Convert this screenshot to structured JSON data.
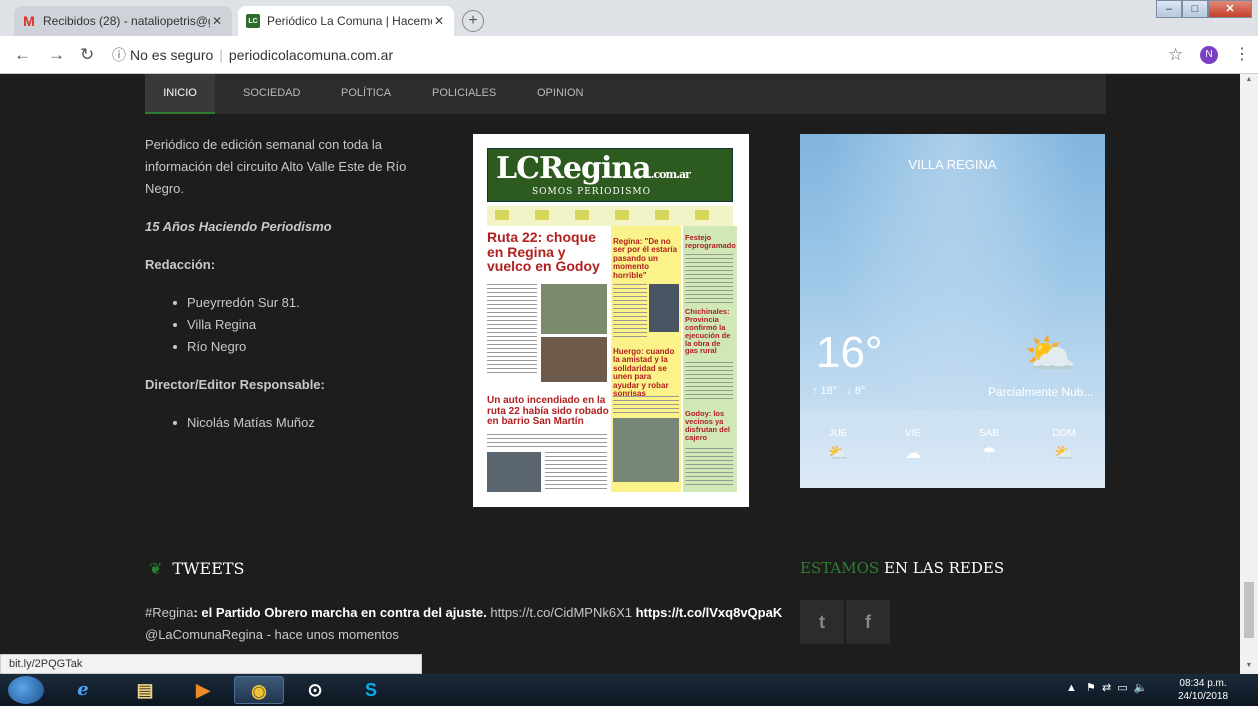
{
  "browser": {
    "tabs": [
      {
        "label": "Recibidos (28) - nataliopetris@g",
        "favicon": "gmail-icon"
      },
      {
        "label": "Periódico La Comuna | Hacemos",
        "favicon": "lc-favicon"
      }
    ],
    "security": "No es seguro",
    "url": "periodicolacomuna.com.ar",
    "profile_initial": "N"
  },
  "nav": {
    "items": [
      "INICIO",
      "SOCIEDAD",
      "POLÍTICA",
      "POLICIALES",
      "OPINION"
    ],
    "active": "INICIO"
  },
  "about": {
    "description": "Periódico de edición semanal con toda la información del circuito Alto Valle Este de Río Negro.",
    "tagline": "15 Años Haciendo Periodismo",
    "redaccion_label": "Redacción:",
    "address": [
      "Pueyrredón Sur 81.",
      "Villa Regina",
      "Río Negro"
    ],
    "director_label": "Director/Editor Responsable:",
    "director": "Nicolás Matías Muñoz"
  },
  "newspaper": {
    "logo": "LCRegina",
    "logo_suffix": ".com.ar",
    "subtitle": "SOMOS PERIODISMO",
    "headline_main": "Ruta 22: choque en Regina y vuelco en Godoy",
    "headline_second": "Un auto incendiado en la ruta 22 había sido robado en barrio San Martín",
    "col2_title": "Regina: \"De no ser por él estaría pasando un momento horrible\"",
    "col2_second": "Huergo: cuando la amistad y la solidaridad se unen para ayudar y robar sonrisas",
    "col3_title": "Festejo reprogramado",
    "col3_second": "Chichinales: Provincia confirmó la ejecución de la obra de gas rural",
    "col3_third": "Godoy: los vecinos ya disfrutan del cajero"
  },
  "weather": {
    "city": "VILLA REGINA",
    "temperature": "16°",
    "high": "↑ 18°",
    "low": "↓ 8°",
    "condition": "Parcialmente Nub...",
    "forecast": [
      {
        "day": "JUE",
        "icon": "partly-cloudy-icon"
      },
      {
        "day": "VIE",
        "icon": "cloud-icon"
      },
      {
        "day": "SAB",
        "icon": "rain-cloud-icon"
      },
      {
        "day": "DOM",
        "icon": "partly-cloudy-icon"
      }
    ]
  },
  "tweets": {
    "title": "TWEETS",
    "hashtag": "#Regina",
    "text": ": el Partido Obrero marcha en contra del ajuste. ",
    "link1": "https://t.co/CidMPNk6X1",
    "link2": " https://t.co/lVxq8vQpaK",
    "author_line": "@LaComunaRegina - hace unos momentos"
  },
  "redes": {
    "title_green": "ESTAMOS",
    "title_white": " EN LAS REDES"
  },
  "status_url": "bit.ly/2PQGTak",
  "taskbar": {
    "time": "08:34 p.m.",
    "date": "24/10/2018"
  },
  "colors": {
    "accent": "#2e7d32",
    "page_bg": "#1e1d1d",
    "nav_bg": "#2d2b2b"
  }
}
